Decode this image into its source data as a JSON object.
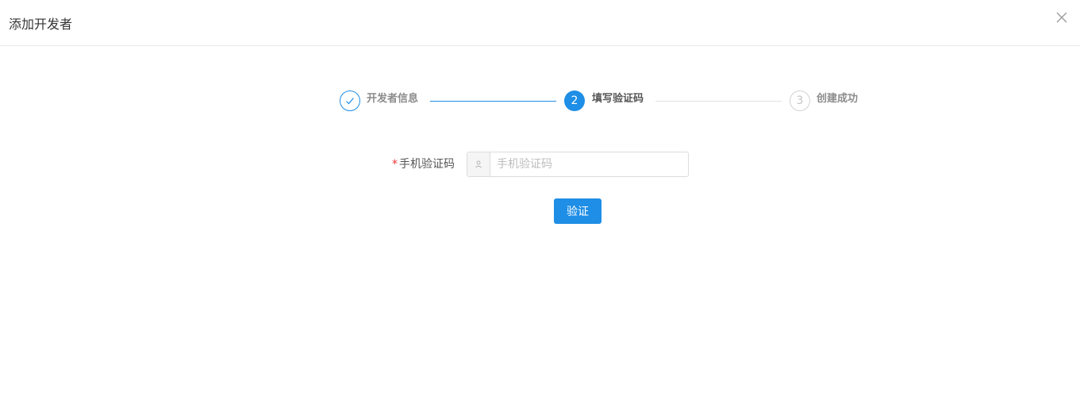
{
  "dialog": {
    "title": "添加开发者",
    "close_icon": "close-icon"
  },
  "steps": [
    {
      "index": "✓",
      "label": "开发者信息",
      "status": "finished"
    },
    {
      "index": "2",
      "label": "填写验证码",
      "status": "active"
    },
    {
      "index": "3",
      "label": "创建成功",
      "status": "pending"
    }
  ],
  "form": {
    "required_mark": "*",
    "sms_code_label": "手机验证码",
    "sms_code_placeholder": "手机验证码",
    "sms_code_value": "",
    "input_icon": "user-icon",
    "submit_label": "验证"
  },
  "colors": {
    "primary": "#1e8ee6",
    "required": "#e33333",
    "pending": "#c4c4c4"
  }
}
